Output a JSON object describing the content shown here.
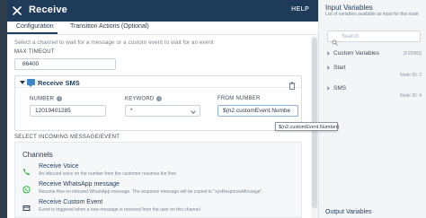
{
  "header": {
    "title": "Receive",
    "help_label": "HELP"
  },
  "tabs": [
    {
      "label": "Configuration",
      "active": true
    },
    {
      "label": "Transition Actions (Optional)",
      "active": false
    }
  ],
  "config": {
    "intro": "Select a channel to wait for a message or a custom event to wait for an event",
    "max_timeout_label": "MAX TIMEOUT",
    "max_timeout_value": "86400"
  },
  "receive_sms": {
    "title": "Receive SMS",
    "number_label": "NUMBER",
    "number_value": "12019401285",
    "keyword_label": "KEYWORD",
    "keyword_value": "*",
    "from_number_label": "FROM NUMBER",
    "from_number_value": "$(n2.customEvent.Numbe",
    "tooltip": "$(n2.customEvent.Number)"
  },
  "incoming": {
    "section_label": "SELECT INCOMING MESSAGE/EVENT",
    "channels_title": "Channels",
    "channels": [
      {
        "icon": "phone-icon",
        "name": "Receive Voice",
        "desc": "An inbound voice on the number from the customer resumes the flow"
      },
      {
        "icon": "whatsapp-icon",
        "name": "Receive WhatsApp message",
        "desc": "Resume flow on inbound WhatsApp message. The response message will be copied to \"sysResponseMessage\"."
      },
      {
        "icon": "custom-event-icon",
        "name": "Receive Custom Event",
        "desc": "Event is triggered when a new message is received from the user on this channel"
      }
    ]
  },
  "right_panel": {
    "title": "Input Variables",
    "subtitle": "List of variables available as input for this node",
    "search_placeholder": "Search",
    "items": [
      {
        "label": "Custom Variables",
        "meta": "[F20982]",
        "meta2": ""
      },
      {
        "label": "Start",
        "meta": "",
        "meta2": "Node ID: 2"
      },
      {
        "label": "SMS",
        "meta": "",
        "meta2": "Node ID: 4"
      }
    ],
    "footer": "Output Variables"
  },
  "colors": {
    "header_bg": "#1f3b5a",
    "accent": "#3f86c7",
    "whatsapp": "#2bb741"
  }
}
